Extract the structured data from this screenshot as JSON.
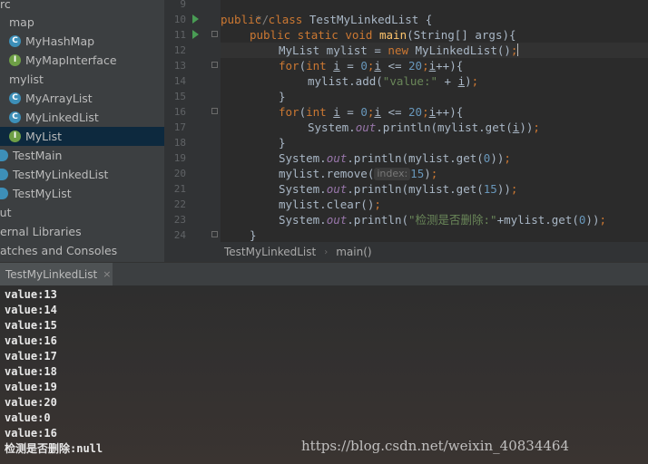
{
  "project_tree": {
    "items": [
      {
        "label": "rc",
        "icon": "folder-icon",
        "selected": false
      },
      {
        "label": "map",
        "icon": "folder-icon",
        "selected": false
      },
      {
        "label": "MyHashMap",
        "icon": "class-icon",
        "selected": false
      },
      {
        "label": "MyMapInterface",
        "icon": "interface-icon",
        "selected": false
      },
      {
        "label": "mylist",
        "icon": "folder-icon",
        "selected": false
      },
      {
        "label": "MyArrayList",
        "icon": "class-icon",
        "selected": false
      },
      {
        "label": "MyLinkedList",
        "icon": "class-icon",
        "selected": false
      },
      {
        "label": "MyList",
        "icon": "interface-icon",
        "selected": true
      },
      {
        "label": "TestMain",
        "icon": "run-class-icon",
        "selected": false
      },
      {
        "label": "TestMyLinkedList",
        "icon": "run-class-icon",
        "selected": false
      },
      {
        "label": "TestMyList",
        "icon": "run-class-icon",
        "selected": false
      },
      {
        "label": "out",
        "icon": "folder-icon",
        "selected": false
      },
      {
        "label": "ernal Libraries",
        "icon": "library-icon",
        "selected": false
      },
      {
        "label": "atches and Consoles",
        "icon": "scratch-icon",
        "selected": false
      }
    ]
  },
  "editor": {
    "line_numbers": [
      "9",
      "10",
      "11",
      "12",
      "13",
      "14",
      "15",
      "16",
      "17",
      "18",
      "19",
      "20",
      "21",
      "22",
      "23",
      "24"
    ],
    "lines": {
      "l9": "*/",
      "l10_a": "public class ",
      "l10_b": "TestMyLinkedList {",
      "l11_a": "public static void ",
      "l11_b": "main",
      "l11_c": "(String[] args){",
      "l12_a": "MyList mylist = ",
      "l12_b": "new ",
      "l12_c": "MyLinkedList()",
      "l12_d": ";",
      "l13_a": "for",
      "l13_b": "(",
      "l13_c": "int ",
      "l13_d": "i",
      "l13_e": " = ",
      "l13_f": "0",
      "l13_g": ";",
      "l13_h": "i",
      "l13_i": " <= ",
      "l13_j": "20",
      "l13_k": ";",
      "l13_l": "i",
      "l13_m": "++){",
      "l14_a": "mylist.add(",
      "l14_b": "\"value:\"",
      "l14_c": " + ",
      "l14_d": "i",
      "l14_e": ")",
      "l14_f": ";",
      "l15": "}",
      "l16_a": "for",
      "l16_b": "(",
      "l16_c": "int ",
      "l16_d": "i",
      "l16_e": " = ",
      "l16_f": "0",
      "l16_g": ";",
      "l16_h": "i",
      "l16_i": " <= ",
      "l16_j": "20",
      "l16_k": ";",
      "l16_l": "i",
      "l16_m": "++){",
      "l17_a": "System.",
      "l17_b": "out",
      "l17_c": ".println(mylist.get(",
      "l17_d": "i",
      "l17_e": "))",
      "l17_f": ";",
      "l18": "}",
      "l19_a": "System.",
      "l19_b": "out",
      "l19_c": ".println(mylist.get(",
      "l19_d": "0",
      "l19_e": "))",
      "l19_f": ";",
      "l20_a": "mylist.remove(",
      "l20_hint": "index:",
      "l20_b": "15",
      "l20_c": ")",
      "l20_d": ";",
      "l21_a": "System.",
      "l21_b": "out",
      "l21_c": ".println(mylist.get(",
      "l21_d": "15",
      "l21_e": "))",
      "l21_f": ";",
      "l22_a": "mylist.clear()",
      "l22_b": ";",
      "l23_a": "System.",
      "l23_b": "out",
      "l23_c": ".println(",
      "l23_d": "\"检测是否删除:\"",
      "l23_e": "+mylist.get(",
      "l23_f": "0",
      "l23_g": "))",
      "l23_h": ";",
      "l24": "}"
    }
  },
  "breadcrumb": {
    "items": [
      "TestMyLinkedList",
      "main()"
    ],
    "separator": "›"
  },
  "run_panel": {
    "tab_label": "TestMyLinkedList",
    "close_label": "×",
    "output": [
      "value:13",
      "value:14",
      "value:15",
      "value:16",
      "value:17",
      "value:18",
      "value:19",
      "value:20",
      "value:0",
      "value:16",
      "检测是否删除:null"
    ]
  },
  "watermark": "https://blog.csdn.net/weixin_40834464",
  "colors": {
    "keyword": "#cc7832",
    "method": "#ffc66d",
    "number": "#6897bb",
    "string": "#6a8759",
    "static_field": "#9876aa",
    "selection": "#0d293e",
    "class_icon": "#3d8fb8",
    "interface_icon": "#6e9f46"
  }
}
